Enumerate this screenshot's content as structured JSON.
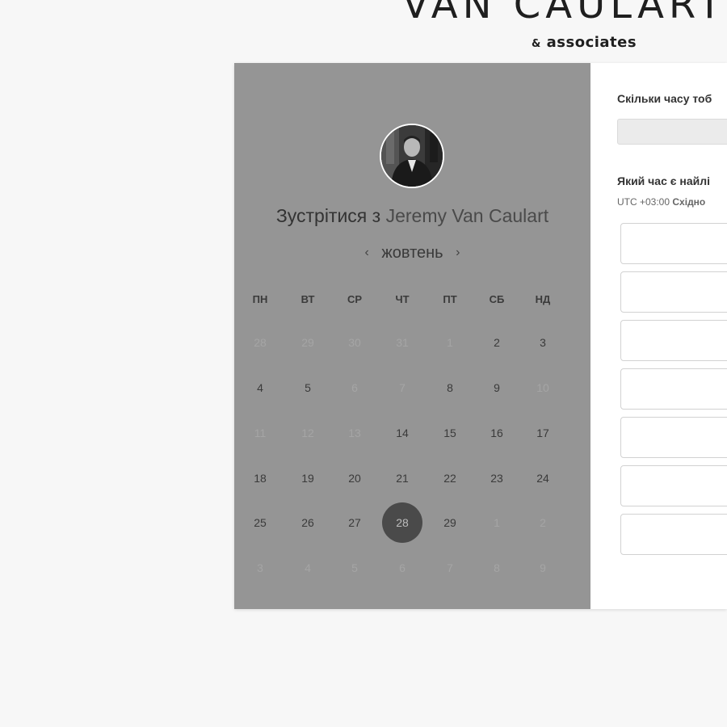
{
  "brand": {
    "title": "VAN CAULART",
    "sub_amp": "&",
    "sub_text": "associates"
  },
  "booking": {
    "meet_prefix": "Зустрітися з",
    "host_name": "Jeremy Van Caulart",
    "month": "жовтень",
    "prev_arrow": "‹",
    "next_arrow": "›",
    "weekdays": [
      "ПН",
      "ВТ",
      "СР",
      "ЧТ",
      "ПТ",
      "СБ",
      "НД"
    ],
    "weeks": [
      [
        "28",
        "29",
        "30",
        "31",
        "1",
        "2",
        "3"
      ],
      [
        "4",
        "5",
        "6",
        "7",
        "8",
        "9",
        "10"
      ],
      [
        "11",
        "12",
        "13",
        "14",
        "15",
        "16",
        "17"
      ],
      [
        "18",
        "19",
        "20",
        "21",
        "22",
        "23",
        "24"
      ],
      [
        "25",
        "26",
        "27",
        "28",
        "29",
        "1",
        "2"
      ],
      [
        "3",
        "4",
        "5",
        "6",
        "7",
        "8",
        "9"
      ]
    ],
    "day_states": [
      [
        "muted",
        "muted",
        "muted",
        "muted",
        "muted",
        "cur",
        "cur"
      ],
      [
        "cur",
        "cur",
        "muted",
        "muted",
        "cur",
        "cur",
        "muted"
      ],
      [
        "muted",
        "muted",
        "muted",
        "cur",
        "cur",
        "cur",
        "cur"
      ],
      [
        "cur",
        "cur",
        "cur",
        "cur",
        "cur",
        "cur",
        "cur"
      ],
      [
        "cur",
        "cur",
        "cur",
        "sel",
        "cur",
        "muted",
        "muted"
      ],
      [
        "muted",
        "muted",
        "muted",
        "muted",
        "muted",
        "muted",
        "muted"
      ]
    ],
    "question_duration": "Скільки часу тоб",
    "duration_value": "",
    "question_time": "Який час є найлі",
    "timezone_offset": "UTC +03:00",
    "timezone_name": "Східно",
    "slot_count": 7
  },
  "colors": {
    "page_bg": "#f7f7f7",
    "left_panel_bg": "#959595",
    "selected_day_bg": "#4a4a4a",
    "right_panel_bg": "#ffffff"
  }
}
